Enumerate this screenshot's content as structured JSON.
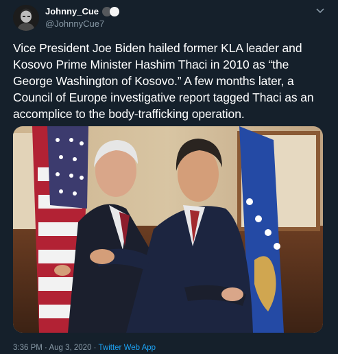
{
  "author": {
    "display_name": "Johnny_Cue",
    "handle": "@JohnnyCue7"
  },
  "tweet": {
    "text": "Vice President Joe Biden hailed former KLA leader and Kosovo Prime Minister Hashim Thaci in 2010 as “the George Washington of Kosovo.” A few months later, a Council of Europe investigative report tagged Thaci as an accomplice to the body-trafficking operation."
  },
  "meta": {
    "time": "3:36 PM",
    "separator": "·",
    "date": "Aug 3, 2020",
    "source": "Twitter Web App"
  },
  "icons": {
    "more": "chevron-down-icon"
  },
  "colors": {
    "background": "#15202b",
    "text": "#ffffff",
    "secondary_text": "#8899a6",
    "link": "#1da1f2"
  }
}
